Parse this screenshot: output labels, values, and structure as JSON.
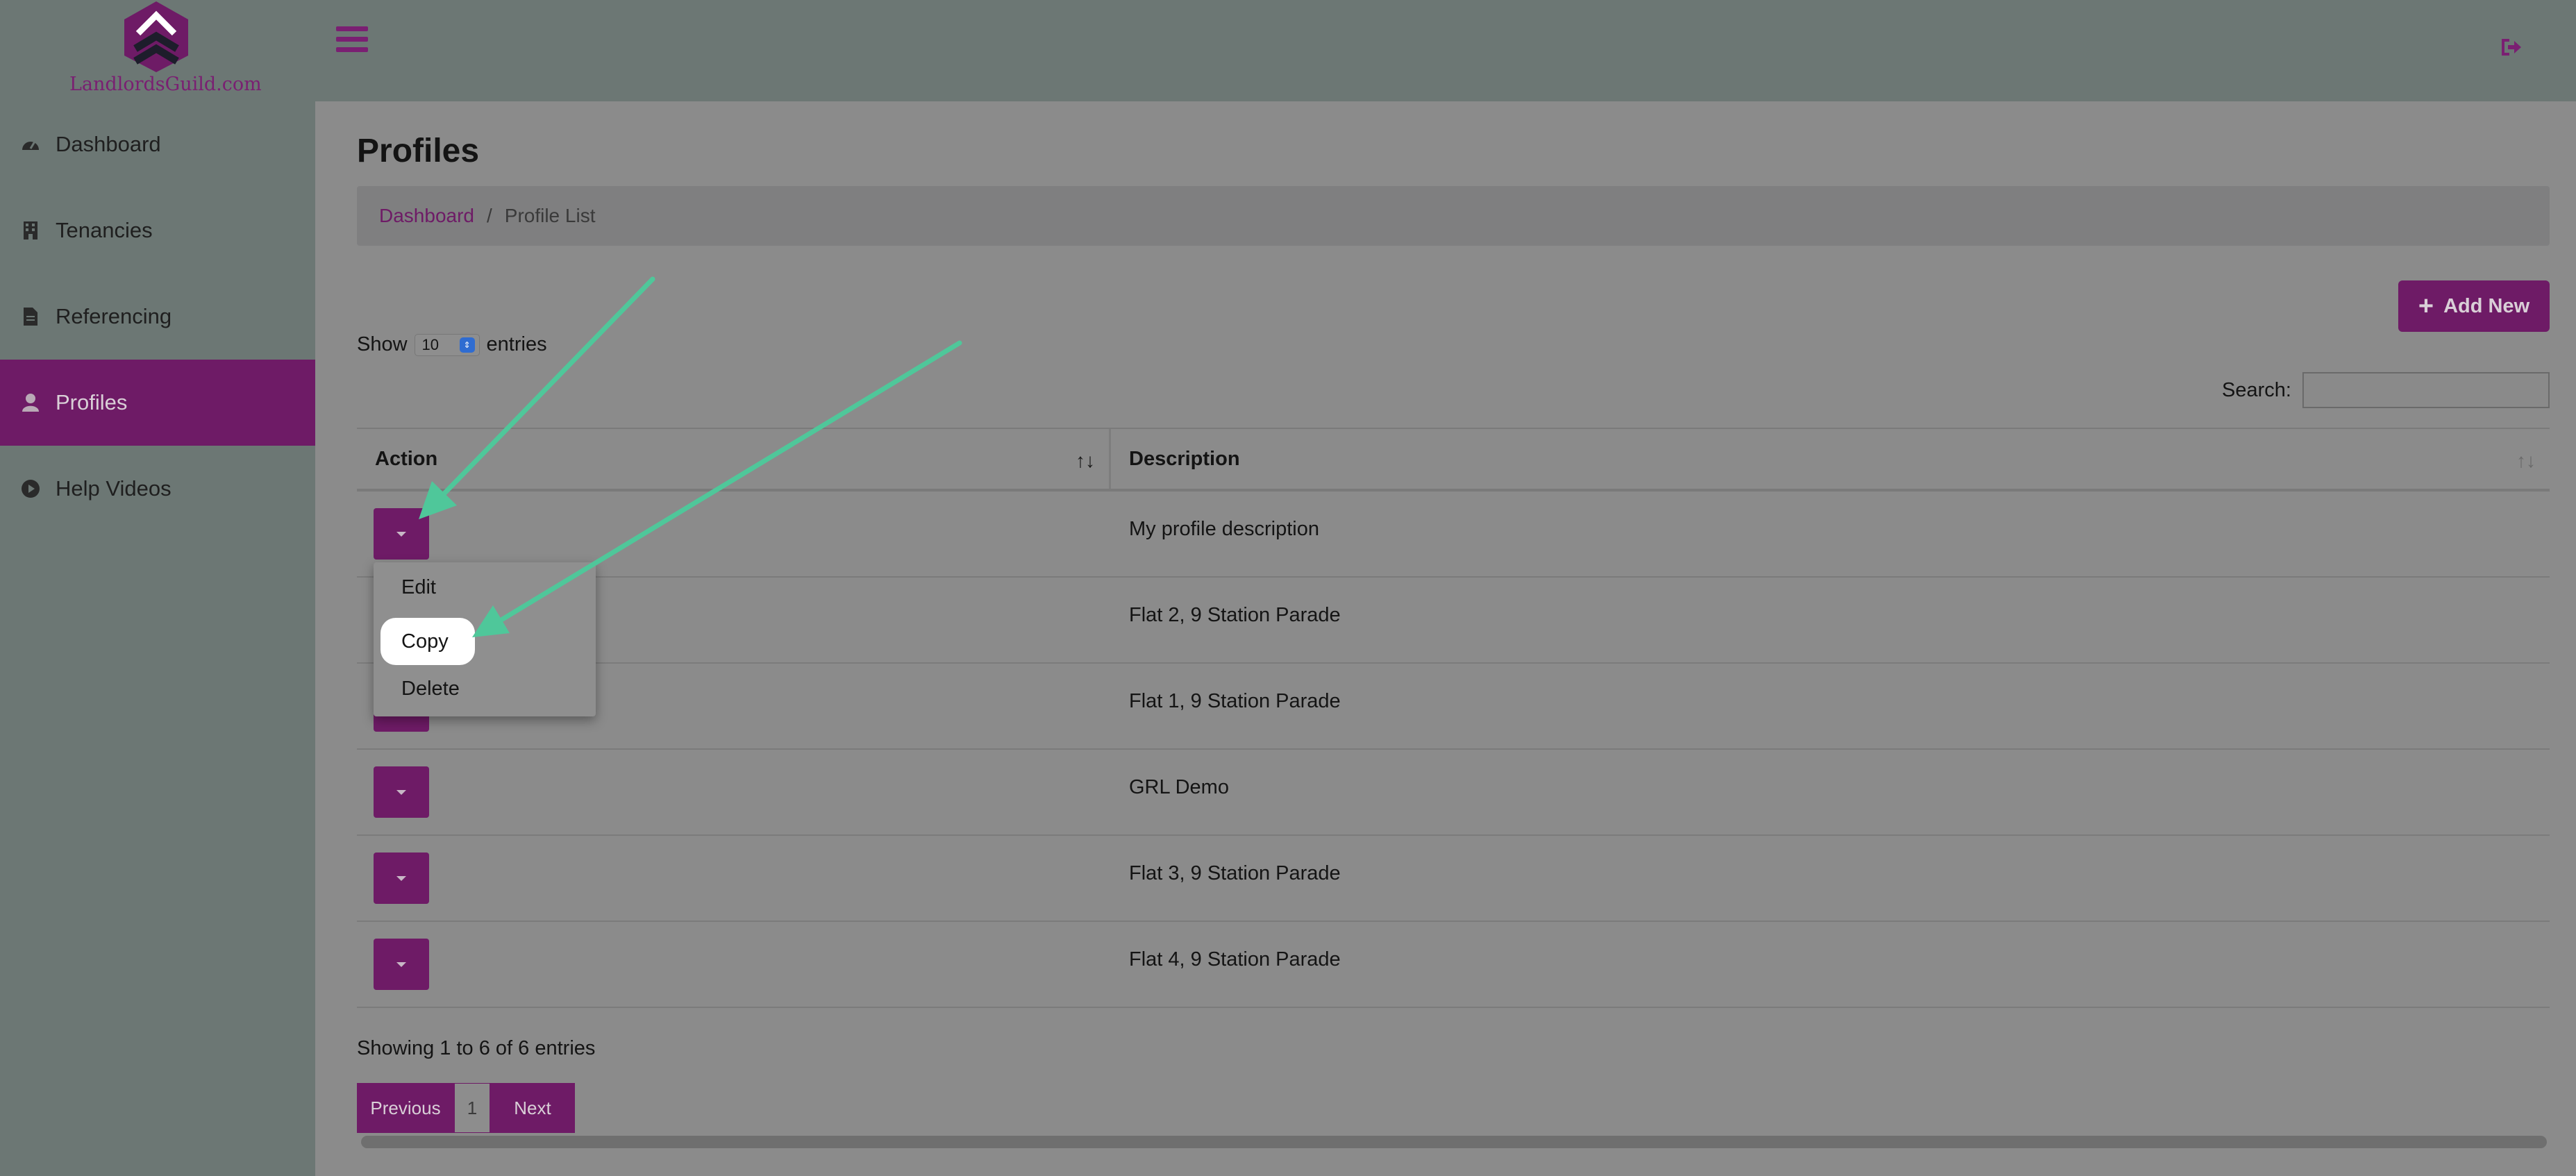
{
  "brand": {
    "logo_text": "LandlordsGuild.com"
  },
  "sidebar": {
    "items": [
      {
        "label": "Dashboard",
        "icon": "dashboard-icon"
      },
      {
        "label": "Tenancies",
        "icon": "building-icon"
      },
      {
        "label": "Referencing",
        "icon": "document-icon"
      },
      {
        "label": "Profiles",
        "icon": "user-icon",
        "active": true
      },
      {
        "label": "Help Videos",
        "icon": "play-circle-icon"
      }
    ]
  },
  "page": {
    "title": "Profiles",
    "breadcrumb": {
      "link": "Dashboard",
      "separator": "/",
      "current": "Profile List"
    },
    "add_button": "Add New"
  },
  "table_controls": {
    "show_label": "Show",
    "entries_value": "10",
    "entries_label": "entries",
    "search_label": "Search:",
    "search_value": ""
  },
  "table": {
    "columns": [
      "Action",
      "Description"
    ],
    "rows": [
      "My profile description",
      "Flat 2, 9 Station Parade",
      "Flat 1, 9 Station Parade",
      "GRL Demo",
      "Flat 3, 9 Station Parade",
      "Flat 4, 9 Station Parade"
    ]
  },
  "dropdown": {
    "edit": "Edit",
    "copy": "Copy",
    "delete": "Delete"
  },
  "footer": {
    "info": "Showing 1 to 6 of 6 entries",
    "prev": "Previous",
    "page": "1",
    "next": "Next"
  },
  "colors": {
    "accent": "#6e1b66",
    "annotation": "#4fc79a"
  }
}
